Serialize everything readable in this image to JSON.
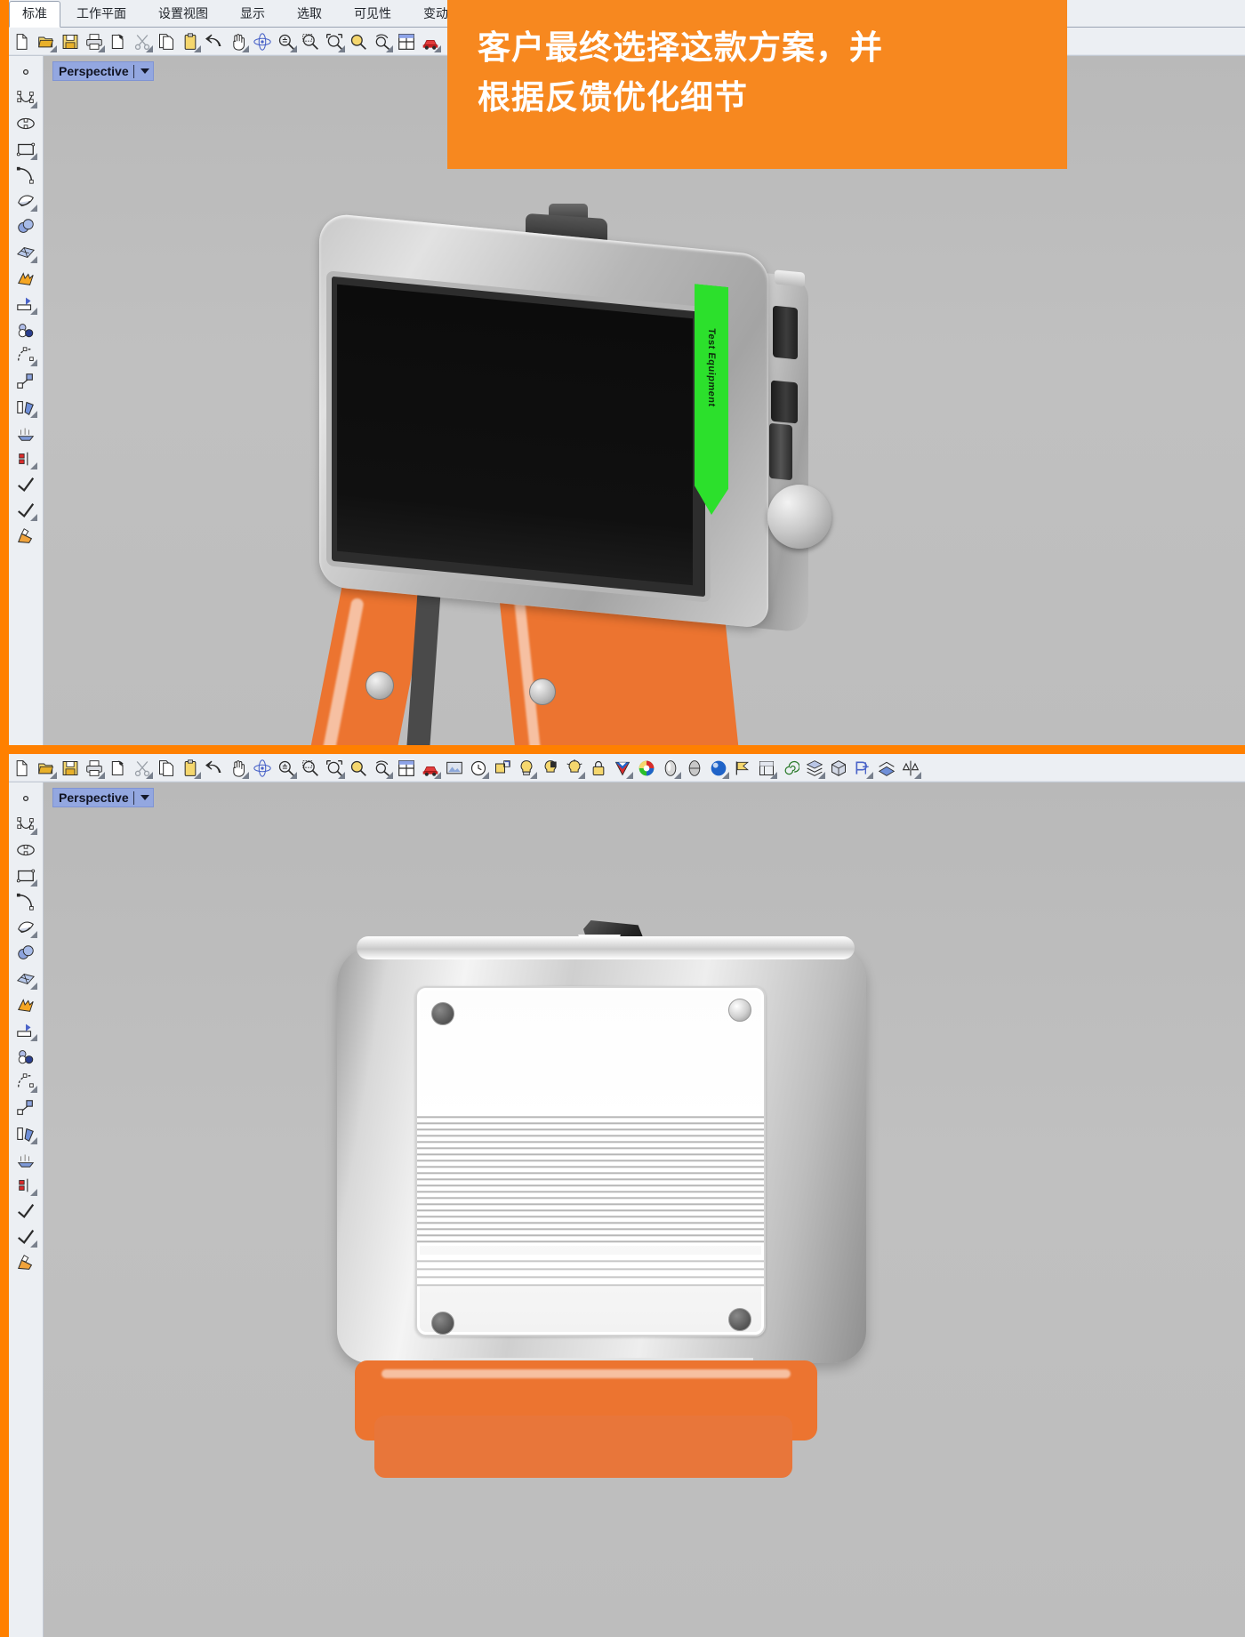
{
  "banner": {
    "background_color": "#f7881f",
    "text_color": "#ffffff",
    "line1": "客户最终选择这款方案，并",
    "line2": "根据反馈优化细节"
  },
  "page": {
    "background_color": "#ff8000",
    "app_background": "#eceff3",
    "viewport_background": "#bdbdbd"
  },
  "panel_top": {
    "menubar": {
      "tabs": [
        {
          "label": "标准",
          "active": true
        },
        {
          "label": "工作平面",
          "active": false
        },
        {
          "label": "设置视图",
          "active": false
        },
        {
          "label": "显示",
          "active": false
        },
        {
          "label": "选取",
          "active": false
        },
        {
          "label": "可见性",
          "active": false
        },
        {
          "label": "变动",
          "active": false
        }
      ]
    },
    "toolbar": {
      "icons": [
        "new-document-icon",
        "open-folder-icon",
        "save-icon",
        "print-icon",
        "copy-to-file-icon",
        "cut-scissors-icon",
        "copy-icon",
        "paste-icon",
        "undo-arrow-icon",
        "pan-hand-icon",
        "rotate-view-icon",
        "zoom-in-out-icon",
        "zoom-window-icon",
        "zoom-selected-icon",
        "zoom-extents-icon",
        "zoom-dynamic-icon",
        "viewport-layout-icon",
        "render-car-icon"
      ]
    },
    "sidebar": {
      "icons": [
        "point-icon",
        "control-point-curve-icon",
        "ellipse-icon",
        "rectangle-icon",
        "arc-curve-icon",
        "surface-sweep-icon",
        "sphere-solid-icon",
        "surface-mesh-icon",
        "boolean-split-icon",
        "extrude-icon",
        "boolean-union-icon",
        "fillet-curve-icon",
        "transform-icon",
        "mirror-icon",
        "array-icon",
        "dimension-icon",
        "annotate-icon",
        "check-analyze-icon",
        "render-paint-icon"
      ]
    },
    "viewport": {
      "label": "Perspective",
      "label_background": "#93a7e0",
      "caret": "chevron-down-icon"
    },
    "model": {
      "name": "test-equipment-front-view",
      "device_label": "Test Equipment",
      "device_label_color": "#2ce02c",
      "body_color": "#bdbdbd",
      "screen_color": "#0c0c0c",
      "stand_color": "#ec7430"
    }
  },
  "panel_bottom": {
    "toolbar": {
      "icons": [
        "new-document-icon",
        "open-folder-icon",
        "save-icon",
        "print-icon",
        "copy-to-file-icon",
        "cut-scissors-icon",
        "copy-icon",
        "paste-icon",
        "undo-arrow-icon",
        "pan-hand-icon",
        "rotate-view-icon",
        "zoom-in-out-icon",
        "zoom-window-icon",
        "zoom-selected-icon",
        "zoom-extents-icon",
        "zoom-dynamic-icon",
        "viewport-layout-icon",
        "render-car-icon",
        "render-preview-icon",
        "clock-history-icon",
        "named-view-icon",
        "spot-light-icon",
        "rect-light-icon",
        "point-light-icon",
        "lock-light-icon",
        "material-palette-icon",
        "color-wheel-icon",
        "environment-icon",
        "ground-plane-icon",
        "render-sphere-icon",
        "flag-icon",
        "layout-icon",
        "spiral-icon",
        "layer-stack-icon",
        "block-icon",
        "gumball-icon",
        "section-icon",
        "analysis-icon"
      ]
    },
    "sidebar": {
      "icons": [
        "point-icon",
        "control-point-curve-icon",
        "ellipse-icon",
        "rectangle-icon",
        "arc-curve-icon",
        "surface-sweep-icon",
        "sphere-solid-icon",
        "surface-mesh-icon",
        "boolean-split-icon",
        "extrude-icon",
        "boolean-union-icon",
        "fillet-curve-icon",
        "transform-icon",
        "mirror-icon",
        "array-icon",
        "dimension-icon",
        "annotate-icon",
        "check-analyze-icon",
        "render-paint-icon"
      ]
    },
    "viewport": {
      "label": "Perspective",
      "label_background": "#93a7e0",
      "caret": "chevron-down-icon"
    },
    "model": {
      "name": "test-equipment-rear-view",
      "body_color": "#d8d8d8",
      "plate_color": "#ffffff",
      "stand_color": "#ec7430"
    }
  }
}
